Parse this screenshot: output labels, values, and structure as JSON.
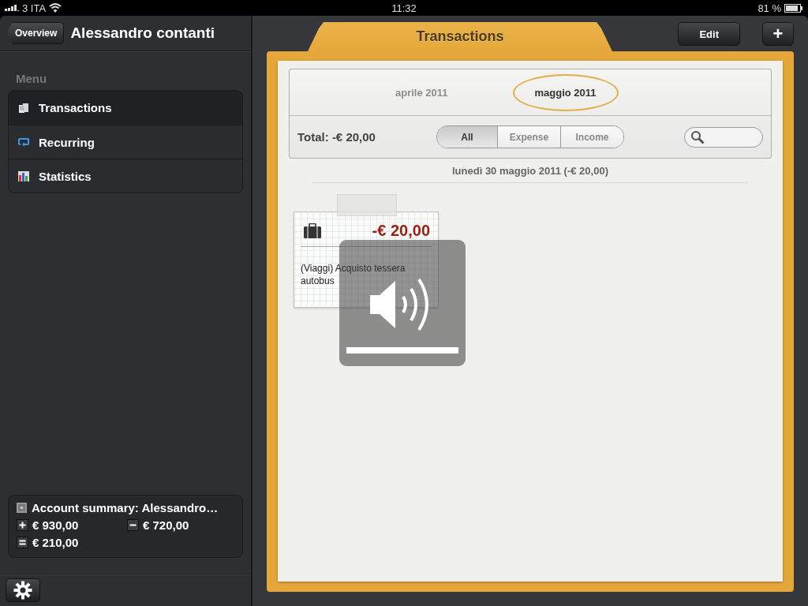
{
  "status_bar": {
    "carrier": "3 ITA",
    "time": "11:32",
    "battery": "81 %"
  },
  "sidebar": {
    "back_button": "Overview",
    "title": "Alessandro contanti",
    "menu_heading": "Menu",
    "items": [
      {
        "label": "Transactions",
        "kind": "transactions",
        "selected": true
      },
      {
        "label": "Recurring",
        "kind": "recurring",
        "selected": false
      },
      {
        "label": "Statistics",
        "kind": "statistics",
        "selected": false
      }
    ],
    "summary": {
      "title": "Account summary: Alessandro…",
      "income": "€ 930,00",
      "expense": "€ 720,00",
      "balance": "€ 210,00"
    }
  },
  "main": {
    "tab_title": "Transactions",
    "edit_button": "Edit",
    "add_button": "+",
    "months": [
      {
        "label": "aprile 2011",
        "selected": false
      },
      {
        "label": "maggio 2011",
        "selected": true
      }
    ],
    "total": "Total: -€ 20,00",
    "filters": [
      {
        "label": "All",
        "selected": true
      },
      {
        "label": "Expense",
        "selected": false
      },
      {
        "label": "Income",
        "selected": false
      }
    ],
    "day_header": "lunedì 30 maggio 2011 (-€ 20,00)",
    "transactions": [
      {
        "amount": "-€ 20,00",
        "description": "(Viaggi) Acquisto tessera autobus"
      }
    ],
    "volume_hud": {
      "level": 1
    }
  }
}
